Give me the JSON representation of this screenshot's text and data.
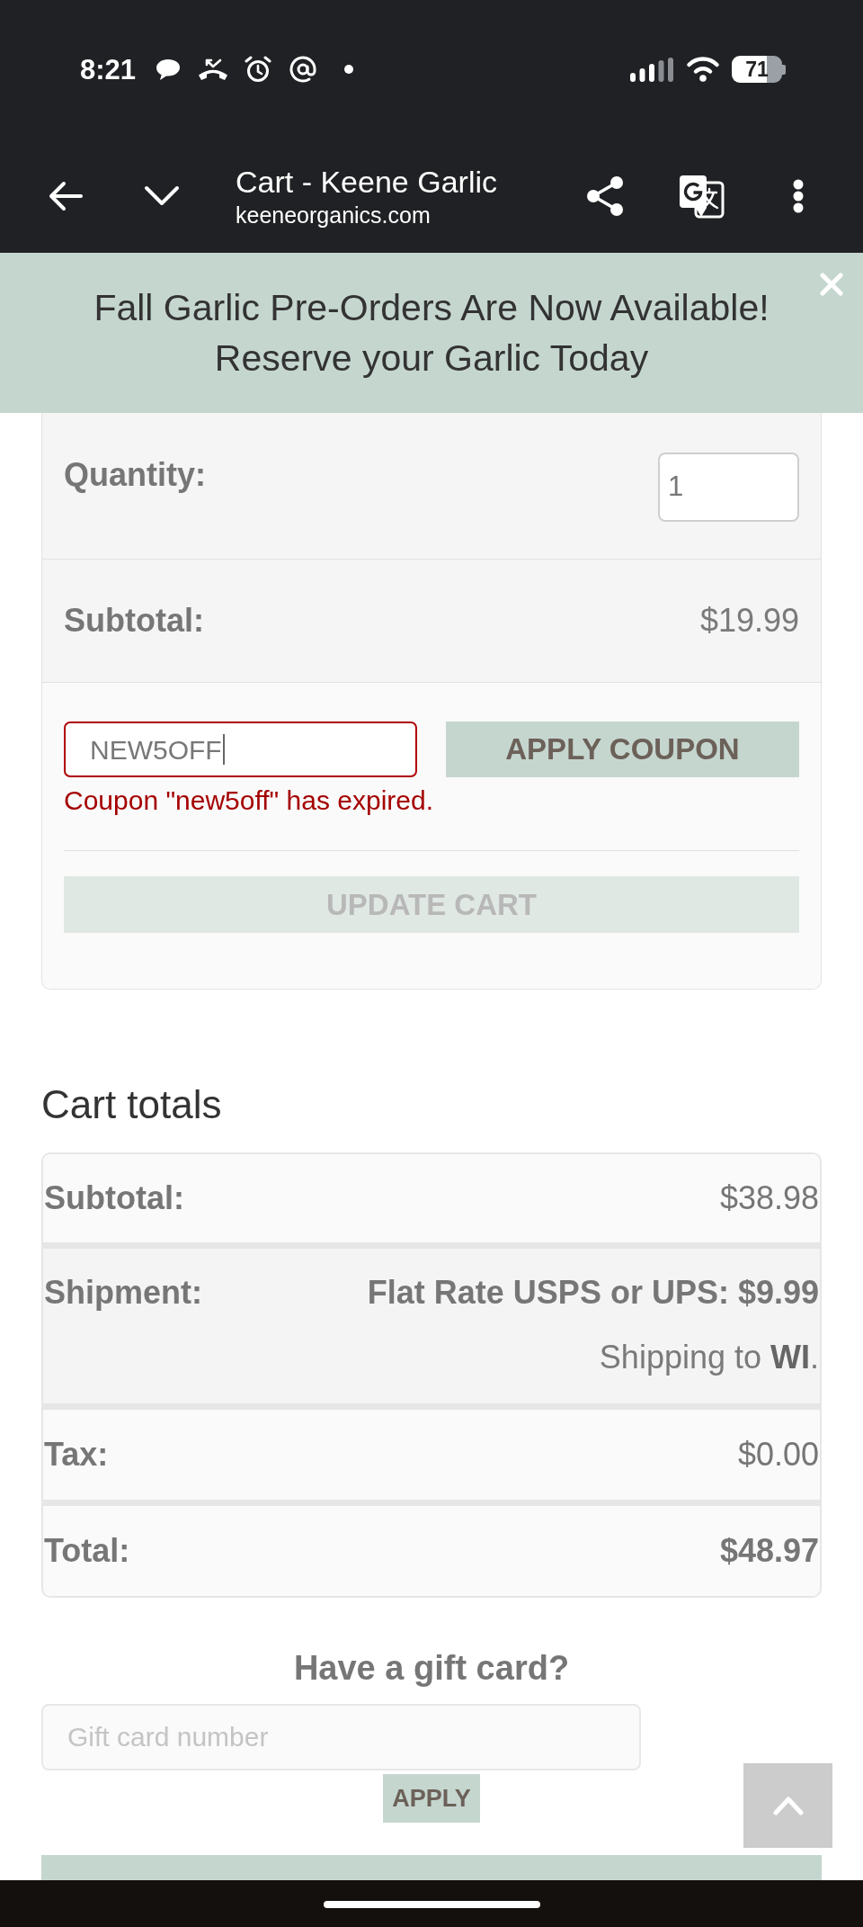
{
  "status_bar": {
    "time": "8:21",
    "battery": "71"
  },
  "browser_bar": {
    "title": "Cart - Keene Garlic",
    "url": "keeneorganics.com"
  },
  "banner": {
    "text": "Fall Garlic Pre-Orders Are Now Available! Reserve your Garlic Today"
  },
  "cart_item": {
    "rows": [
      {
        "kind": "quantity",
        "label": "Quantity:",
        "value": "1"
      },
      {
        "kind": "amount",
        "label": "Subtotal:",
        "value": "$19.99"
      }
    ]
  },
  "coupon": {
    "value": "NEW5OFF",
    "invalid": true,
    "error": "Coupon \"new5off\" has expired.",
    "button": "APPLY COUPON"
  },
  "update_cart": {
    "label": "UPDATE CART",
    "disabled": true
  },
  "cart_totals": {
    "title": "Cart totals",
    "rows": [
      {
        "kind": "amount",
        "label": "Subtotal:",
        "value": "$38.98"
      },
      {
        "kind": "shipping",
        "label": "Shipment:",
        "value": "Flat Rate USPS or UPS: $9.99",
        "note": "Shipping to **WI**."
      },
      {
        "kind": "amount",
        "label": "Tax:",
        "value": "$0.00"
      },
      {
        "kind": "total",
        "label": "Total:",
        "value": "$48.97"
      }
    ]
  },
  "gift_card": {
    "title": "Have a gift card?",
    "placeholder": "Gift card number",
    "button": "APPLY"
  }
}
